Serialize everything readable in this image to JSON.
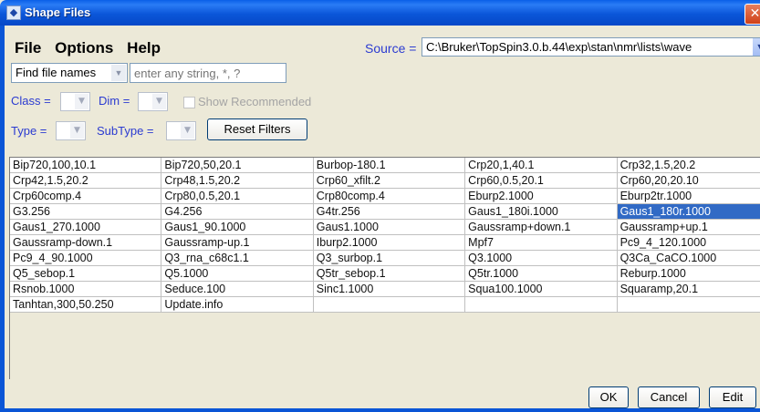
{
  "window": {
    "title": "Shape Files",
    "close_glyph": "✕"
  },
  "menu": [
    "File",
    "Options",
    "Help"
  ],
  "source": {
    "label": "Source =",
    "path": "C:\\Bruker\\TopSpin3.0.b.44\\exp\\stan\\nmr\\lists\\wave"
  },
  "find": {
    "mode": "Find file names",
    "placeholder": "enter any string, *, ?"
  },
  "filters": {
    "class_label": "Class =",
    "dim_label": "Dim =",
    "show_recommended": "Show Recommended",
    "type_label": "Type =",
    "subtype_label": "SubType =",
    "reset": "Reset Filters"
  },
  "table": {
    "rows": [
      [
        "Bip720,100,10.1",
        "Bip720,50,20.1",
        "Burbop-180.1",
        "Crp20,1,40.1",
        "Crp32,1.5,20.2"
      ],
      [
        "Crp42,1.5,20.2",
        "Crp48,1.5,20.2",
        "Crp60_xfilt.2",
        "Crp60,0.5,20.1",
        "Crp60,20,20.10"
      ],
      [
        "Crp60comp.4",
        "Crp80,0.5,20.1",
        "Crp80comp.4",
        "Eburp2.1000",
        "Eburp2tr.1000"
      ],
      [
        "G3.256",
        "G4.256",
        "G4tr.256",
        "Gaus1_180i.1000",
        "Gaus1_180r.1000"
      ],
      [
        "Gaus1_270.1000",
        "Gaus1_90.1000",
        "Gaus1.1000",
        "Gaussramp+down.1",
        "Gaussramp+up.1"
      ],
      [
        "Gaussramp-down.1",
        "Gaussramp-up.1",
        "Iburp2.1000",
        "Mpf7",
        "Pc9_4_120.1000"
      ],
      [
        "Pc9_4_90.1000",
        "Q3_rna_c68c1.1",
        "Q3_surbop.1",
        "Q3.1000",
        "Q3Ca_CaCO.1000"
      ],
      [
        "Q5_sebop.1",
        "Q5.1000",
        "Q5tr_sebop.1",
        "Q5tr.1000",
        "Reburp.1000"
      ],
      [
        "Rsnob.1000",
        "Seduce.100",
        "Sinc1.1000",
        "Squa100.1000",
        "Squaramp,20.1"
      ],
      [
        "Tanhtan,300,50.250",
        "Update.info",
        "",
        "",
        ""
      ]
    ],
    "selected": "Gaus1_180r.1000"
  },
  "buttons": {
    "ok": "OK",
    "cancel": "Cancel",
    "edit": "Edit"
  },
  "colors": {
    "title_bar": "#0b56d9",
    "selection": "#316ac5",
    "filter_label": "#2b3bd1"
  }
}
